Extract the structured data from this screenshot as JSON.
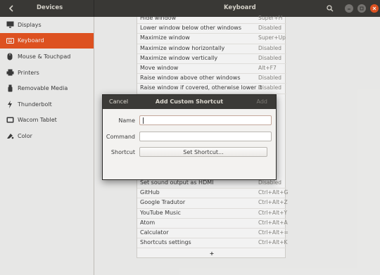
{
  "header": {
    "left_title": "Devices",
    "title": "Keyboard"
  },
  "sidebar": {
    "items": [
      {
        "label": "Displays",
        "icon": "display-icon"
      },
      {
        "label": "Keyboard",
        "icon": "keyboard-icon",
        "active": true
      },
      {
        "label": "Mouse & Touchpad",
        "icon": "mouse-icon"
      },
      {
        "label": "Printers",
        "icon": "printer-icon"
      },
      {
        "label": "Removable Media",
        "icon": "removable-media-icon"
      },
      {
        "label": "Thunderbolt",
        "icon": "thunderbolt-icon"
      },
      {
        "label": "Wacom Tablet",
        "icon": "tablet-icon"
      },
      {
        "label": "Color",
        "icon": "color-icon"
      }
    ]
  },
  "shortcuts_top": [
    {
      "name": "Hide window",
      "key": "Super+H"
    },
    {
      "name": "Lower window below other windows",
      "key": "Disabled"
    },
    {
      "name": "Maximize window",
      "key": "Super+Up"
    },
    {
      "name": "Maximize window horizontally",
      "key": "Disabled"
    },
    {
      "name": "Maximize window vertically",
      "key": "Disabled"
    },
    {
      "name": "Move window",
      "key": "Alt+F7"
    },
    {
      "name": "Raise window above other windows",
      "key": "Disabled"
    },
    {
      "name": "Raise window if covered, otherwise lower it",
      "key": "Disabled"
    }
  ],
  "shortcuts_bottom": [
    {
      "name": "Set sound output as HDMI",
      "key": "Disabled"
    },
    {
      "name": "GitHub",
      "key": "Ctrl+Alt+G"
    },
    {
      "name": "Google Tradutor",
      "key": "Ctrl+Alt+Z"
    },
    {
      "name": "YouTube Music",
      "key": "Ctrl+Alt+Y"
    },
    {
      "name": "Atom",
      "key": "Ctrl+Alt+A"
    },
    {
      "name": "Calculator",
      "key": "Ctrl+Alt+="
    },
    {
      "name": "Shortcuts settings",
      "key": "Ctrl+Alt+K"
    }
  ],
  "add_row_label": "+",
  "dialog": {
    "cancel": "Cancel",
    "title": "Add Custom Shortcut",
    "add": "Add",
    "name_label": "Name",
    "command_label": "Command",
    "shortcut_label": "Shortcut",
    "name_value": "",
    "command_value": "",
    "set_shortcut": "Set Shortcut..."
  },
  "colors": {
    "accent": "#e95420",
    "headerbar": "#3b3a37"
  }
}
